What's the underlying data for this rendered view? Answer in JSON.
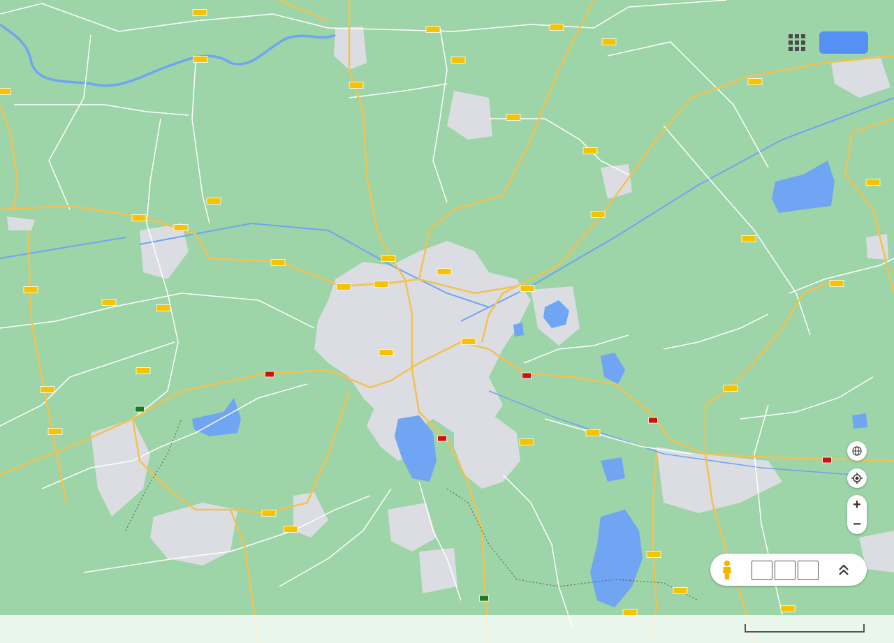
{
  "map": {
    "colors": {
      "land": "#9dd4a8",
      "urban": "#dcdde2",
      "water": "#6fa5f2",
      "road_major": "#f3c151",
      "road_minor": "#ffffff",
      "park": "#7fc98e"
    }
  },
  "traffic_markers": {
    "colors": {
      "normal": "#f7c200",
      "heavy": "#d01010",
      "free": "#1f7a1f"
    }
  },
  "controls": {
    "apps_icon": "apps-grid-icon",
    "globe_icon": "globe-icon",
    "locate_icon": "my-location-icon",
    "zoom_in": "+",
    "zoom_out": "−",
    "pegman_icon": "pegman-icon",
    "expand_icon": "double-chevron-up-icon"
  }
}
